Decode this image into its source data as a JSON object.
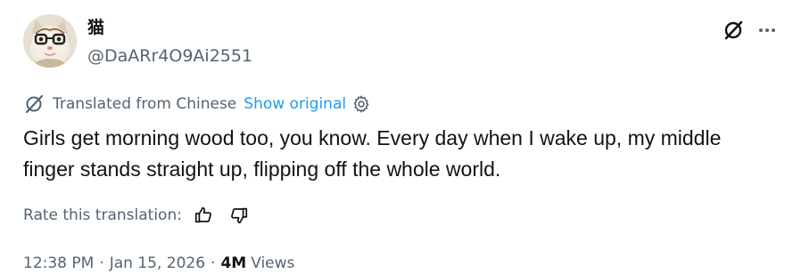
{
  "author": {
    "name": "猫",
    "handle": "@DaARr4O9Ai2551"
  },
  "icons": {
    "grok": "grok-slash-icon",
    "more": "more-horizontal-icon",
    "translate": "translate-icon",
    "settings": "gear-icon",
    "thumbs_up": "thumbs-up-icon",
    "thumbs_down": "thumbs-down-icon"
  },
  "translation": {
    "notice": "Translated from Chinese",
    "show_original": "Show original"
  },
  "tweet": {
    "text": "Girls get morning wood too, you know. Every day when I wake up, my middle finger stands straight up, flipping off the whole world."
  },
  "rating": {
    "label": "Rate this translation:"
  },
  "meta": {
    "time": "12:38 PM",
    "separator": "·",
    "date": "Jan 15, 2026",
    "views_count": "4M",
    "views_label": "Views"
  },
  "colors": {
    "text_primary": "#0f1419",
    "text_secondary": "#536471",
    "link": "#1d9bf0",
    "background": "#ffffff"
  }
}
